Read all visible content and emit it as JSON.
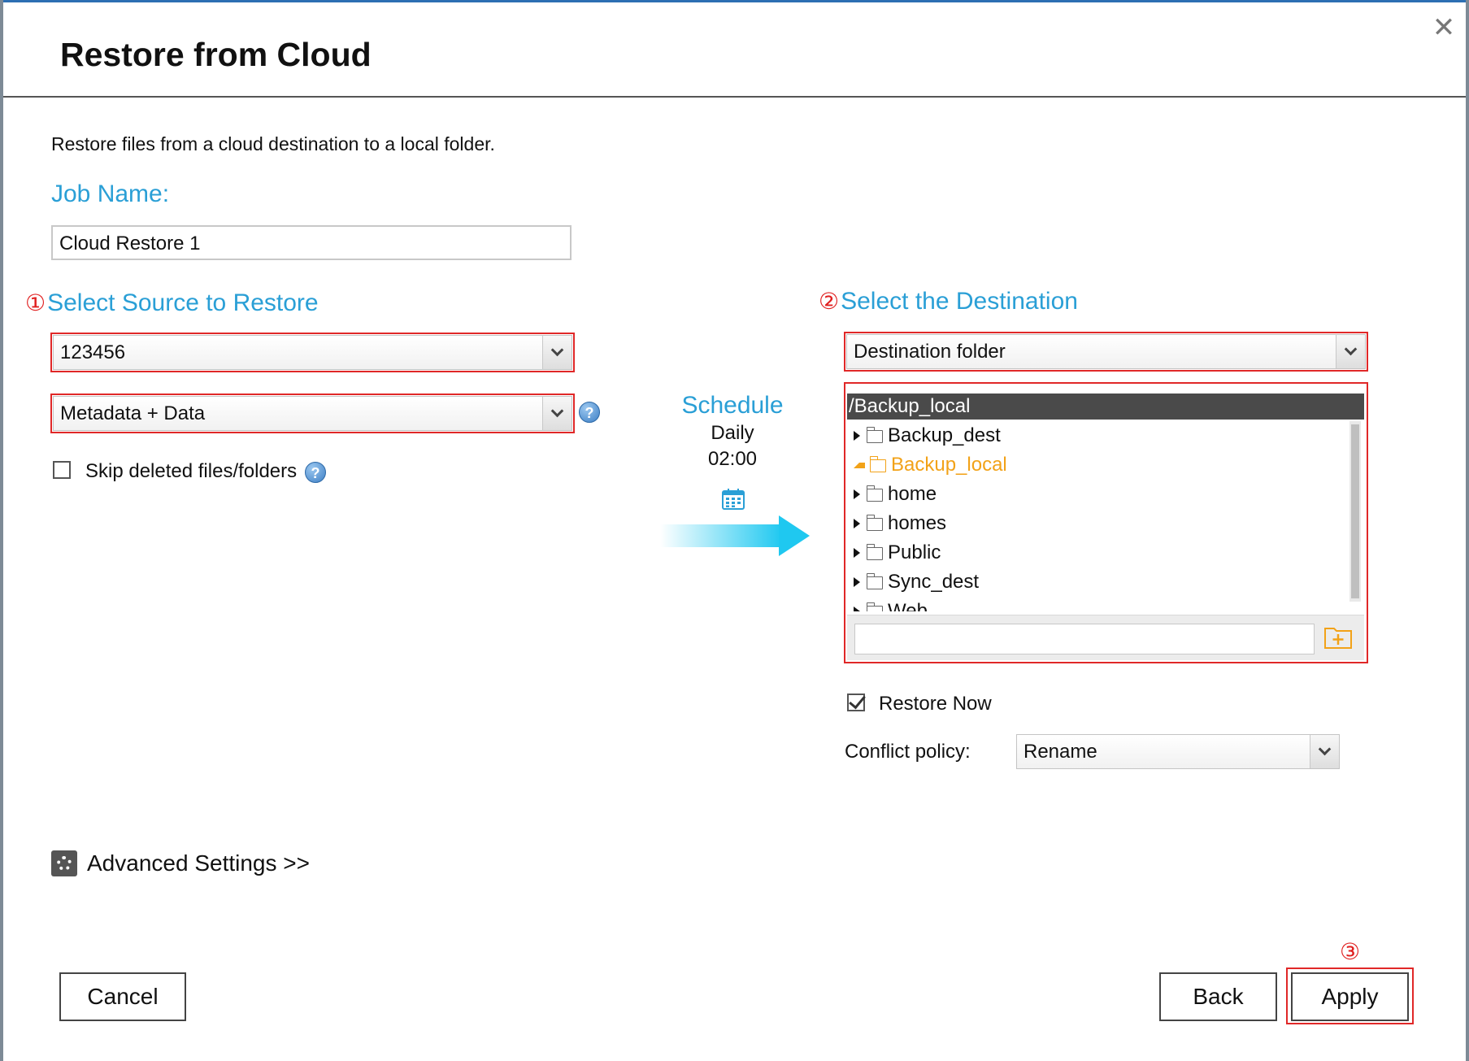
{
  "dialog": {
    "title": "Restore from Cloud",
    "description": "Restore files from a cloud destination to a local folder."
  },
  "job": {
    "label": "Job Name:",
    "value": "Cloud Restore 1"
  },
  "source": {
    "step": "①",
    "label": "Select Source to Restore",
    "cloud_value": "123456",
    "mode_value": "Metadata + Data",
    "help_glyph": "?",
    "skip_label": "Skip deleted files/folders",
    "skip_checked": false
  },
  "schedule": {
    "title": "Schedule",
    "frequency": "Daily",
    "time": "02:00",
    "icon": "calendar-icon",
    "arrow_color": "#1fc8f0"
  },
  "destination": {
    "step": "②",
    "label": "Select the Destination",
    "type_value": "Destination folder",
    "current_path": "/Backup_local",
    "folders": [
      {
        "name": "Backup_dest",
        "expanded": false,
        "selected": false
      },
      {
        "name": "Backup_local",
        "expanded": true,
        "selected": true
      },
      {
        "name": "home",
        "expanded": false,
        "selected": false
      },
      {
        "name": "homes",
        "expanded": false,
        "selected": false
      },
      {
        "name": "Public",
        "expanded": false,
        "selected": false
      },
      {
        "name": "Sync_dest",
        "expanded": false,
        "selected": false
      },
      {
        "name": "Web",
        "expanded": false,
        "selected": false
      }
    ],
    "new_folder_value": "",
    "new_folder_icon": "new-folder-icon",
    "restore_now_label": "Restore Now",
    "restore_now_checked": true,
    "conflict_label": "Conflict policy:",
    "conflict_value": "Rename"
  },
  "advanced": {
    "label": "Advanced Settings >>",
    "icon": "gear-icon"
  },
  "footer": {
    "cancel_label": "Cancel",
    "back_label": "Back",
    "apply_step": "③",
    "apply_label": "Apply"
  },
  "colors": {
    "accent_blue": "#2a9fd6",
    "highlight_red": "#e02828",
    "selected_orange": "#f2a218"
  }
}
